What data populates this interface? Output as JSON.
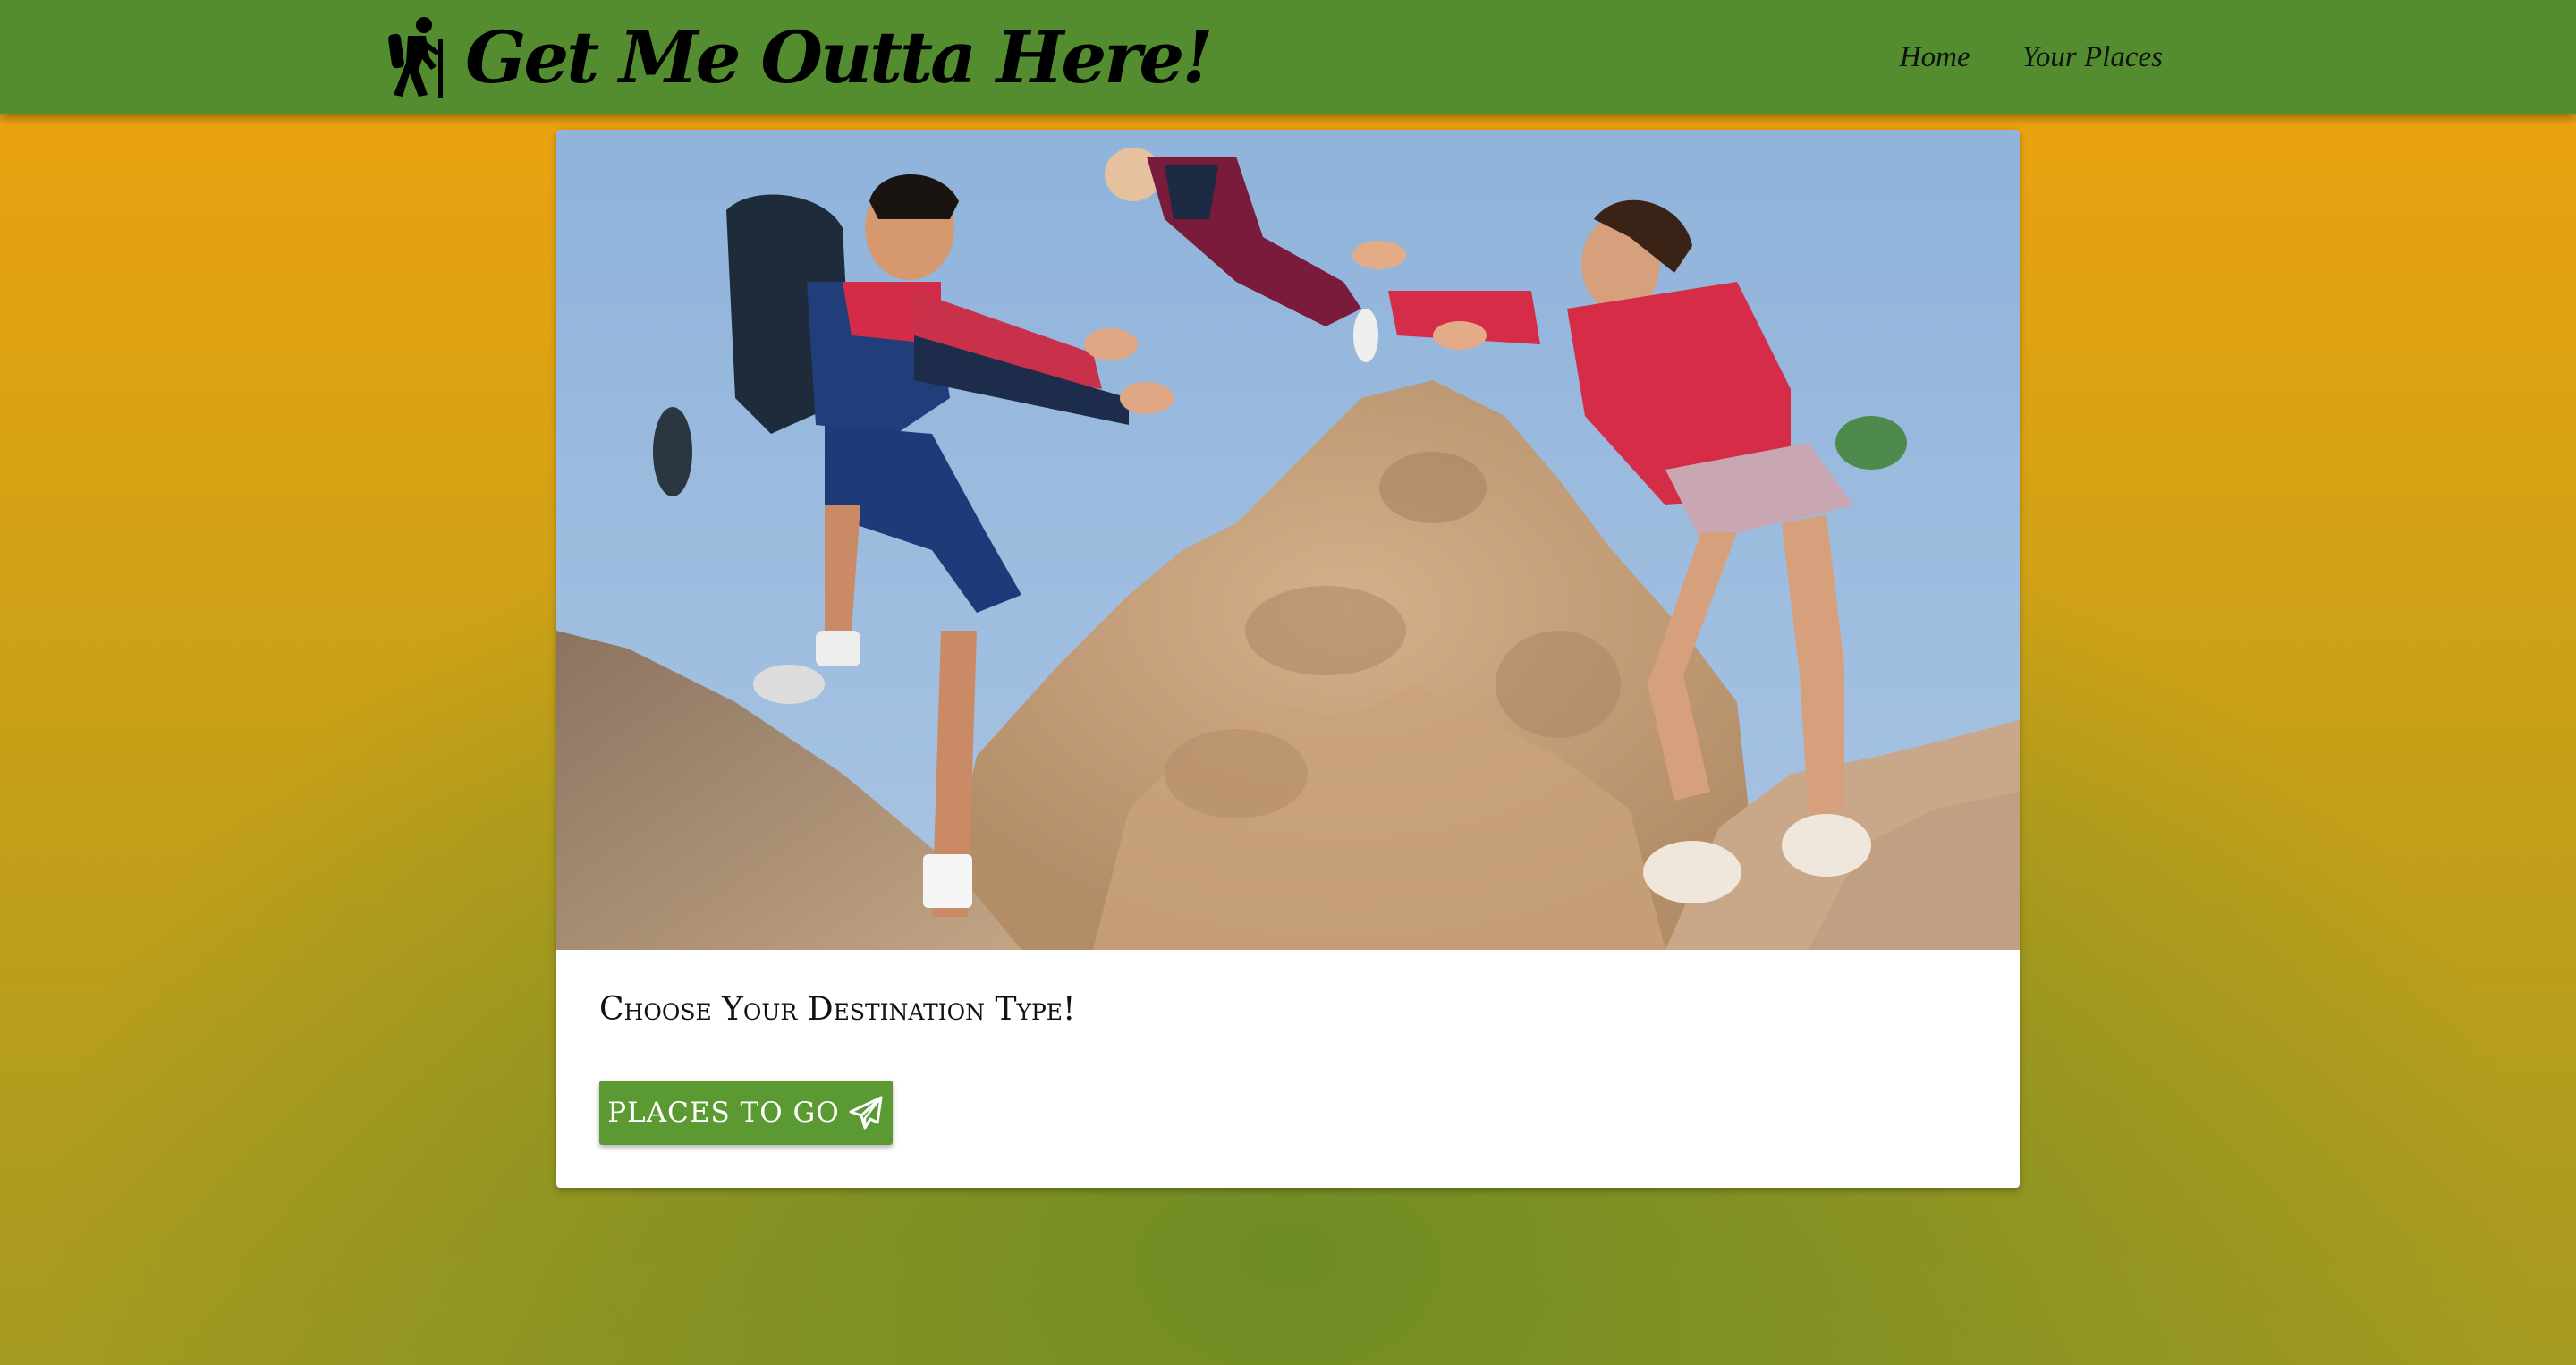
{
  "navbar": {
    "brand_icon": "hiker-icon",
    "title": "Get Me Outta Here!",
    "links": [
      {
        "label": "Home"
      },
      {
        "label": "Your Places"
      }
    ]
  },
  "card": {
    "image_alt": "Family climbing rocks tossing a baby",
    "title": "Choose Your Destination Type!",
    "button": {
      "label": "PLACES TO GO",
      "icon": "paper-plane-icon"
    }
  },
  "colors": {
    "navbar": "#548d30",
    "button": "#5b9a33",
    "background_top": "#f0a30e",
    "background_bottom": "#6f8c25"
  }
}
